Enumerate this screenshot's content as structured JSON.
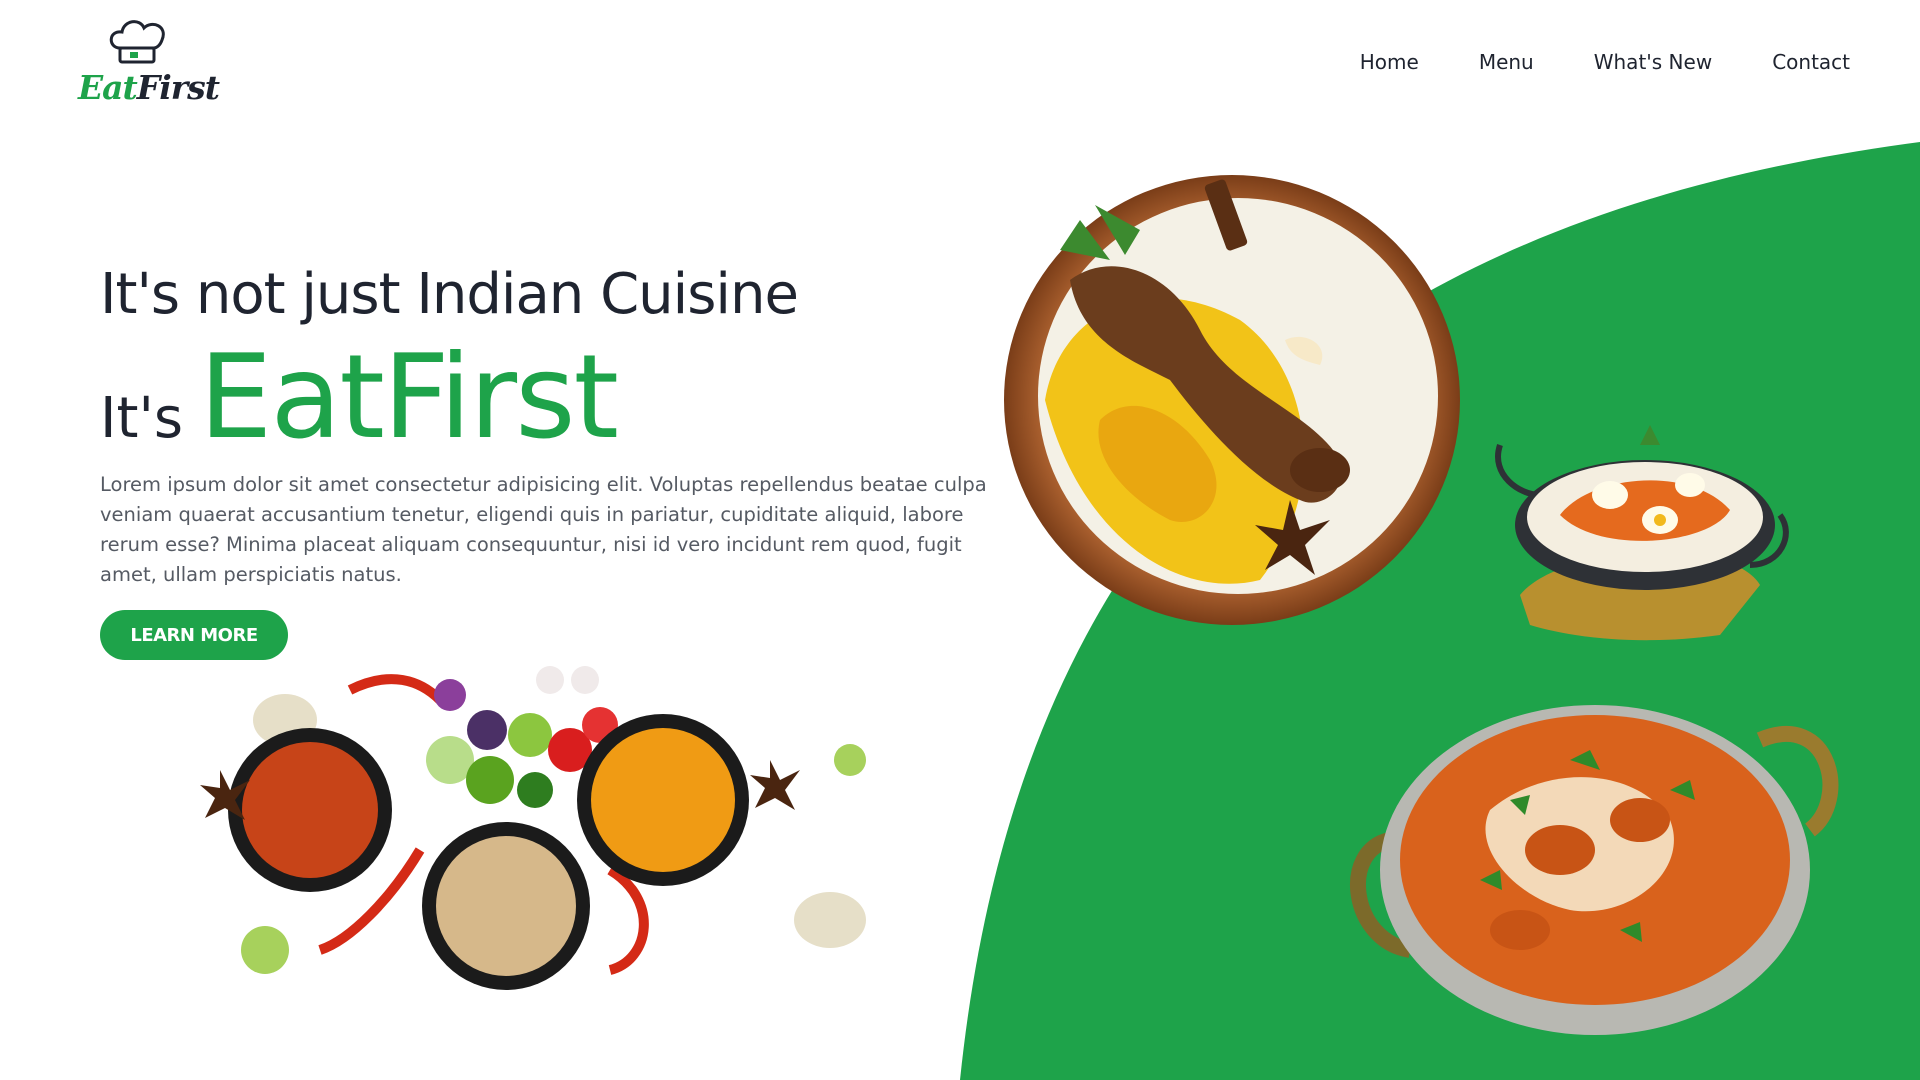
{
  "brand": {
    "logo_part1": "Eat",
    "logo_part2": "First",
    "icon": "chef-hat-icon",
    "accent_color": "#1ea34a",
    "dark_color": "#1f2430"
  },
  "nav": {
    "items": [
      {
        "label": "Home"
      },
      {
        "label": "Menu"
      },
      {
        "label": "What's New"
      },
      {
        "label": "Contact"
      }
    ]
  },
  "hero": {
    "headline": "It's not just Indian Cuisine",
    "its": "It's",
    "brand_name": "EatFirst",
    "description": "Lorem ipsum dolor sit amet consectetur adipisicing elit. Voluptas repellendus beatae culpa veniam quaerat accusantium tenetur, eligendi quis in pariatur, cupiditate aliquid, labore rerum esse? Minima placeat aliquam consequuntur, nisi id vero incidunt rem quod, fugit amet, ullam perspiciatis natus.",
    "cta_label": "LEARN MORE"
  },
  "images": [
    {
      "name": "biryani-plate-image"
    },
    {
      "name": "egg-biryani-karahi-image"
    },
    {
      "name": "butter-chicken-image"
    },
    {
      "name": "spice-bowls-image"
    }
  ]
}
